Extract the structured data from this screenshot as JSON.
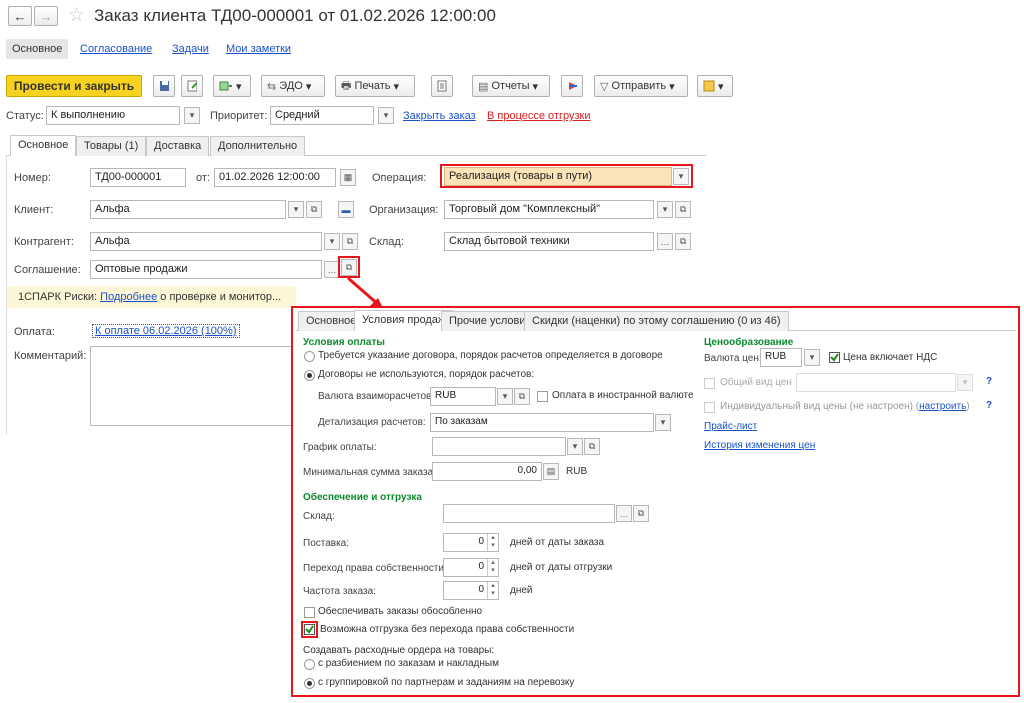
{
  "window": {
    "title": "Заказ клиента ТД00-000001 от 01.02.2026 12:00:00"
  },
  "nav_tabs": [
    "Основное",
    "Согласование",
    "Задачи",
    "Мои заметки"
  ],
  "toolbar": {
    "post_close": "Провести и закрыть",
    "edo": "ЭДО",
    "print": "Печать",
    "reports": "Отчеты",
    "send": "Отправить"
  },
  "status_row": {
    "status_label": "Статус:",
    "status_value": "К выполнению",
    "priority_label": "Приоритет:",
    "priority_value": "Средний",
    "close_order": "Закрыть заказ",
    "shipping_status": "В процессе отгрузки"
  },
  "form_tabs": [
    "Основное",
    "Товары (1)",
    "Доставка",
    "Дополнительно"
  ],
  "form": {
    "number_label": "Номер:",
    "number_value": "ТД00-000001",
    "date_label": "от:",
    "date_value": "01.02.2026 12:00:00",
    "operation_label": "Операция:",
    "operation_value": "Реализация (товары в пути)",
    "client_label": "Клиент:",
    "client_value": "Альфа",
    "org_label": "Организация:",
    "org_value": "Торговый дом \"Комплексный\"",
    "counterparty_label": "Контрагент:",
    "counterparty_value": "Альфа",
    "warehouse_label": "Склад:",
    "warehouse_value": "Склад бытовой техники",
    "agreement_label": "Соглашение:",
    "agreement_value": "Оптовые продажи",
    "spark_prefix": "1СПАРК Риски:",
    "spark_link": "Подробнее",
    "spark_suffix": "о проверке и монитор...",
    "payment_label": "Оплата:",
    "payment_link": "К оплате 06.02.2026 (100%)",
    "comment_label": "Комментарий:"
  },
  "popup": {
    "tabs": [
      "Основное",
      "Условия продаж",
      "Прочие условия",
      "Скидки (наценки) по этому соглашению (0 из 46)"
    ],
    "payment_terms_header": "Условия оплаты",
    "radio_contract": "Требуется указание договора, порядок расчетов определяется в договоре",
    "radio_no_contract": "Договоры не используются, порядок расчетов:",
    "settlement_currency_label": "Валюта взаиморасчетов:",
    "settlement_currency_value": "RUB",
    "foreign_currency_payment": "Оплата в иностранной валюте",
    "settlement_detail_label": "Детализация расчетов:",
    "settlement_detail_value": "По заказам",
    "payment_schedule_label": "График оплаты:",
    "min_order_label": "Минимальная сумма заказа:",
    "min_order_value": "0,00",
    "min_order_currency": "RUB",
    "provision_header": "Обеспечение и отгрузка",
    "warehouse_label": "Склад:",
    "delivery_label": "Поставка:",
    "delivery_value": "0",
    "delivery_unit": "дней от даты заказа",
    "ownership_label": "Переход права собственности:",
    "ownership_value": "0",
    "ownership_unit": "дней от даты отгрузки",
    "frequency_label": "Частота заказа:",
    "frequency_value": "0",
    "frequency_unit": "дней",
    "separate_provision": "Обеспечивать заказы обособленно",
    "ship_without_ownership": "Возможна отгрузка без перехода права собственности",
    "create_orders_label": "Создавать расходные ордера на товары:",
    "radio_split": "с разбиением по заказам и накладным",
    "radio_group": "с группировкой по партнерам и заданиям на перевозку",
    "pricing_header": "Ценообразование",
    "price_currency_label": "Валюта цен:",
    "price_currency_value": "RUB",
    "price_incl_vat": "Цена включает НДС",
    "common_price_type": "Общий вид цен",
    "individual_price_type": "Индивидуальный вид цены (не настроен)",
    "configure_link": "настроить",
    "price_list_link": "Прайс-лист",
    "price_history_link": "История изменения цен",
    "q": "?"
  },
  "colors": {
    "highlight_red": "#e8161b",
    "post_button": "#f7d21e",
    "operation_bg": "#fbe3b8",
    "section_green": "#0d8a2e",
    "link_blue": "#1a52c8"
  }
}
